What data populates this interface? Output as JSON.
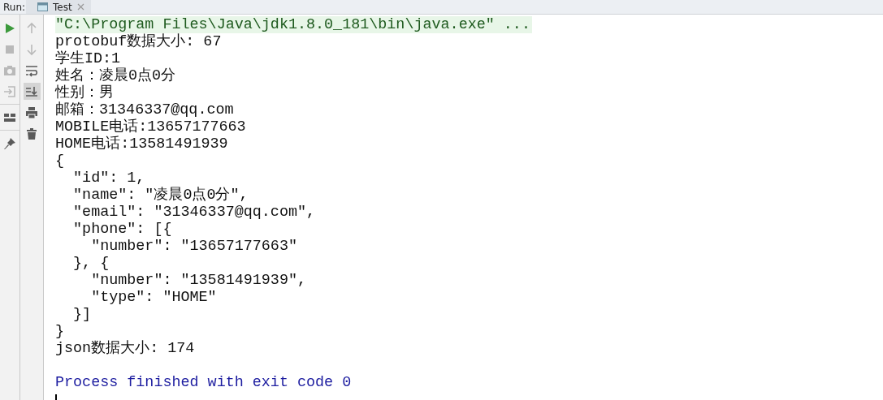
{
  "run_bar": {
    "label": "Run:",
    "tabs": [
      {
        "label": "Test",
        "selected": true
      }
    ]
  },
  "left_toolbar": [
    {
      "kind": "run",
      "disabled": false
    },
    {
      "kind": "stop",
      "disabled": true
    },
    {
      "kind": "camera",
      "disabled": true
    },
    {
      "kind": "import",
      "disabled": true
    },
    {
      "kind": "layout",
      "disabled": false
    },
    {
      "kind": "pin",
      "disabled": false
    }
  ],
  "right_toolbar": [
    {
      "kind": "up",
      "disabled": true,
      "selected": false
    },
    {
      "kind": "down",
      "disabled": true,
      "selected": false
    },
    {
      "kind": "wrap",
      "disabled": false,
      "selected": false
    },
    {
      "kind": "scroll-end",
      "disabled": false,
      "selected": true
    },
    {
      "kind": "print",
      "disabled": false,
      "selected": false
    },
    {
      "kind": "trash",
      "disabled": false,
      "selected": false
    }
  ],
  "console_lines": [
    {
      "kind": "command",
      "text": "\"C:\\Program Files\\Java\\jdk1.8.0_181\\bin\\java.exe\" ..."
    },
    {
      "kind": "output",
      "text": "protobuf数据大小: 67"
    },
    {
      "kind": "output",
      "text": "学生ID:1"
    },
    {
      "kind": "output",
      "text": "姓名：凌晨0点0分"
    },
    {
      "kind": "output",
      "text": "性别：男"
    },
    {
      "kind": "output",
      "text": "邮箱：31346337@qq.com"
    },
    {
      "kind": "output",
      "text": "MOBILE电话:13657177663"
    },
    {
      "kind": "output",
      "text": "HOME电话:13581491939"
    },
    {
      "kind": "output",
      "text": "{"
    },
    {
      "kind": "output",
      "text": "  \"id\": 1,"
    },
    {
      "kind": "output",
      "text": "  \"name\": \"凌晨0点0分\","
    },
    {
      "kind": "output",
      "text": "  \"email\": \"31346337@qq.com\","
    },
    {
      "kind": "output",
      "text": "  \"phone\": [{"
    },
    {
      "kind": "output",
      "text": "    \"number\": \"13657177663\""
    },
    {
      "kind": "output",
      "text": "  }, {"
    },
    {
      "kind": "output",
      "text": "    \"number\": \"13581491939\","
    },
    {
      "kind": "output",
      "text": "    \"type\": \"HOME\""
    },
    {
      "kind": "output",
      "text": "  }]"
    },
    {
      "kind": "output",
      "text": "}"
    },
    {
      "kind": "output",
      "text": "json数据大小: 174"
    },
    {
      "kind": "blank"
    },
    {
      "kind": "system",
      "text": "Process finished with exit code 0"
    }
  ],
  "caret": true
}
